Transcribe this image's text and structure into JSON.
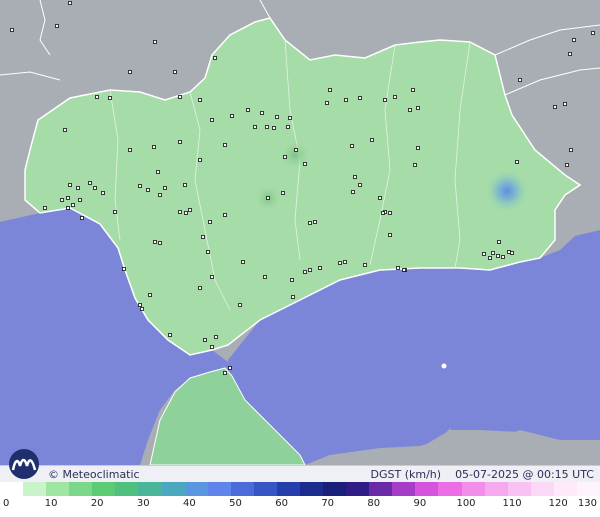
{
  "map": {
    "sea_color": "#7b86d8",
    "land_color": "#a6dca8",
    "outside_color": "#a9adb4",
    "africa_land_color": "#8fd19a"
  },
  "branding": {
    "logo_icon": "meteoclimatic-logo-icon",
    "copyright": "© Meteoclimatic"
  },
  "caption": {
    "variable": "DGST (km/h)",
    "timestamp": "05-07-2025 @ 00:15 UTC"
  },
  "scale": {
    "colors": [
      "#ffffff",
      "#c9f3c9",
      "#9fe6a3",
      "#7bd88a",
      "#5ccb74",
      "#50c080",
      "#4ab59a",
      "#4aa8bf",
      "#5a96e0",
      "#5f85ec",
      "#4b6bd9",
      "#3556c4",
      "#243fab",
      "#1a2d8f",
      "#18207a",
      "#2f1c86",
      "#6a2aa8",
      "#a63dc8",
      "#d553dd",
      "#eb6ee6",
      "#f18ee9",
      "#f5aaee",
      "#f8c3f2",
      "#fbd9f6",
      "#ffe9fb",
      "#fff3fd"
    ],
    "labels": [
      "0",
      "10",
      "20",
      "30",
      "40",
      "50",
      "60",
      "70",
      "80",
      "90",
      "100",
      "110",
      "120",
      "130"
    ]
  }
}
